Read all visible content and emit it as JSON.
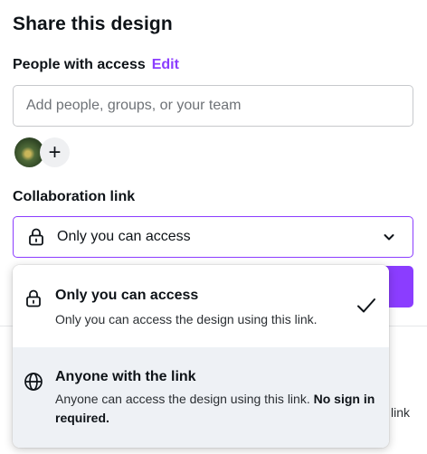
{
  "header": {
    "title": "Share this design"
  },
  "access": {
    "label": "People with access",
    "edit_label": "Edit"
  },
  "people_input": {
    "placeholder": "Add people, groups, or your team",
    "value": ""
  },
  "avatars": {
    "add_symbol": "+"
  },
  "collaboration": {
    "label": "Collaboration link",
    "selected": "Only you can access"
  },
  "dropdown": {
    "options": [
      {
        "title": "Only you can access",
        "description": "Only you can access the design using this link.",
        "selected": true,
        "icon": "lock-icon"
      },
      {
        "title": "Anyone with the link",
        "description": "Anyone can access the design using this link.",
        "description_bold": "No sign in required.",
        "selected": false,
        "icon": "globe-icon"
      }
    ]
  },
  "background": {
    "partial_text": "link"
  },
  "colors": {
    "accent": "#8b3dff",
    "hover_bg": "#eef1f5",
    "text": "#0e1318"
  }
}
